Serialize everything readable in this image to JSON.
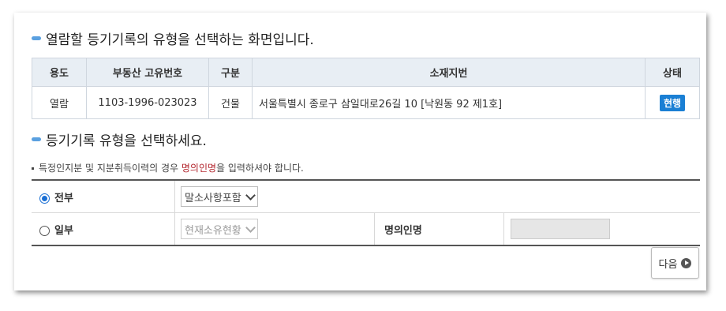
{
  "section1": {
    "title": "열람할 등기기록의 유형을 선택하는 화면입니다."
  },
  "table": {
    "headers": [
      "용도",
      "부동산 고유번호",
      "구분",
      "소재지번",
      "상태"
    ],
    "row": {
      "usage": "열람",
      "id": "1103-1996-023023",
      "type": "건물",
      "address": "서울특별시 종로구 삼일대로26길 10 [낙원동 92 제1호]",
      "status": "현행"
    }
  },
  "section2": {
    "title": "등기기록 유형을 선택하세요."
  },
  "note": {
    "prefix": "특정인지분 및 지분취득이력의 경우 ",
    "highlight": "명의인명",
    "suffix": "을 입력하셔야 합니다."
  },
  "options": {
    "all": {
      "label": "전부",
      "selected": true,
      "select_value": "말소사항포함"
    },
    "partial": {
      "label": "일부",
      "selected": false,
      "select_value": "현재소유현황",
      "name_label": "명의인명",
      "name_value": ""
    }
  },
  "next_button": {
    "label": "다음"
  },
  "colors": {
    "accent": "#1a7fd4",
    "note_red": "#b3262e",
    "header_bg": "#e8eef4"
  }
}
